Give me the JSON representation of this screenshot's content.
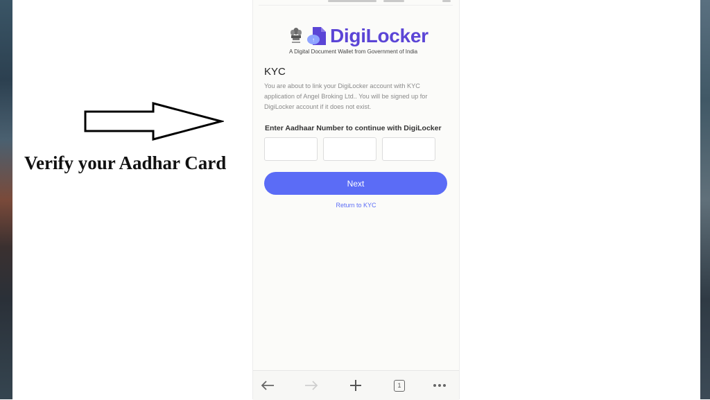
{
  "annotation": {
    "caption": "Verify your Aadhar Card"
  },
  "brand": {
    "name": "DigiLocker",
    "tagline": "A Digital Document Wallet from Government of India",
    "color": "#5b45d6"
  },
  "kyc": {
    "title": "KYC",
    "description": "You are about to link your DigiLocker account with KYC application of Angel Broking Ltd.. You will be signed up for DigiLocker account if it does not exist.",
    "aadhaar_label": "Enter Aadhaar Number to continue with DigiLocker",
    "fields": [
      {
        "value": ""
      },
      {
        "value": ""
      },
      {
        "value": ""
      }
    ],
    "next_label": "Next",
    "return_label": "Return to KYC",
    "accent": "#5b6cf6"
  },
  "browser_nav": {
    "back_icon": "back-arrow-icon",
    "forward_icon": "forward-arrow-icon",
    "new_tab_icon": "plus-icon",
    "tab_count": "1",
    "menu_icon": "more-dots-icon"
  }
}
